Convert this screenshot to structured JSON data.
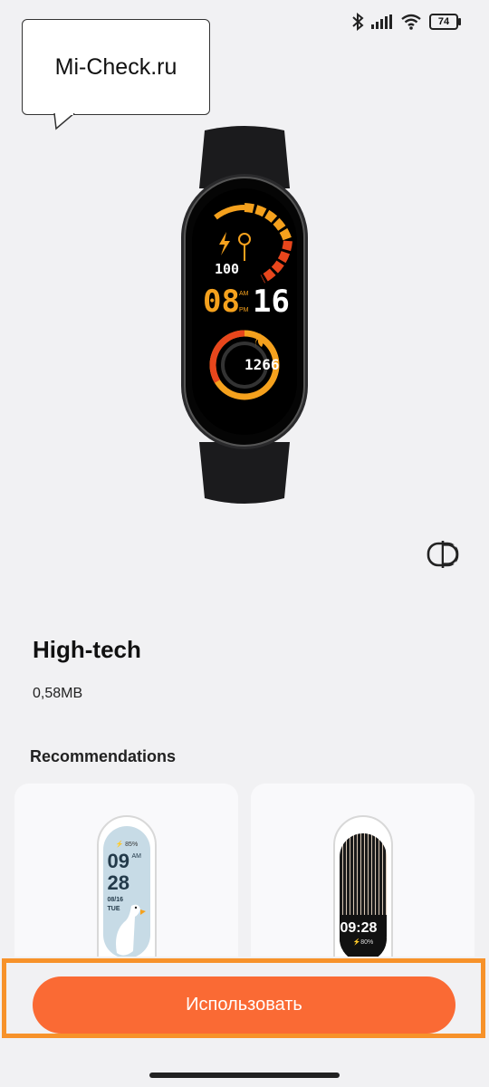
{
  "status_bar": {
    "battery_level": "74",
    "icons": [
      "bluetooth-icon",
      "signal-icon",
      "wifi-icon",
      "battery-icon"
    ]
  },
  "watermark": {
    "text": "Mi-Check.ru"
  },
  "watch_face_preview": {
    "battery_value": "100",
    "time_hours": "08",
    "time_minutes": "16",
    "am_label": "AM",
    "pm_label": "PM",
    "calories": "1266"
  },
  "face": {
    "title": "High-tech",
    "size": "0,58MB"
  },
  "recommendations": {
    "title": "Recommendations",
    "items": [
      {
        "battery": "⚡ 85%",
        "hours": "09",
        "minutes": "28",
        "am": "AM",
        "date": "08/16",
        "weekday": "TUE"
      },
      {
        "time": "09:28",
        "battery": "⚡80%"
      }
    ]
  },
  "actions": {
    "use_label": "Использовать"
  },
  "colors": {
    "accent": "#fa6a34",
    "highlight": "#f7922a",
    "background": "#f1f1f3"
  }
}
